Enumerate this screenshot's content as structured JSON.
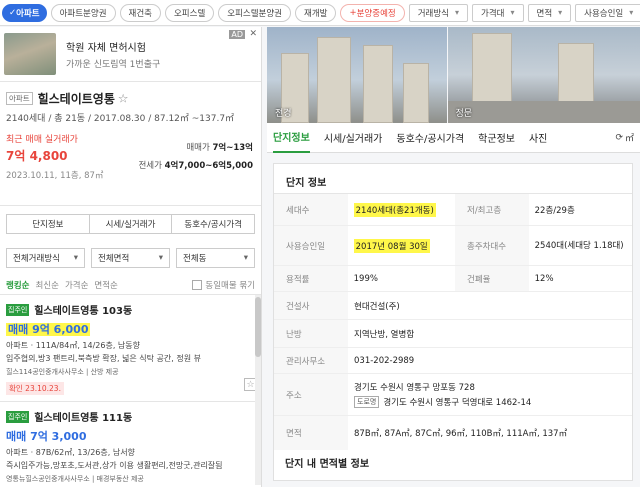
{
  "filters": {
    "active": "아파트",
    "chips": [
      "아파트분양권",
      "재건축",
      "오피스텔",
      "오피스텔분양권",
      "재개발"
    ],
    "highlight_chip": "분양중예정",
    "dropdowns": [
      "거래방식",
      "가격대",
      "면적",
      "사용승인일"
    ]
  },
  "ad": {
    "title": "학원 자체 면허시험",
    "subtitle": "가까운 신도림역 1번출구",
    "badge": "AD",
    "close": "✕"
  },
  "complex": {
    "tag": "아파트",
    "name": "힐스테이트영통",
    "star": "☆",
    "info": "2140세대 / 총 21동 / 2017.08.30 / 87.12㎡ ~137.7㎡",
    "recent_label": "최근 매매 실거래가",
    "recent_price": "7억 4,800",
    "recent_date": "2023.10.11, 11층, 87㎡",
    "sale_label": "매매가",
    "sale_value": "7억~13억",
    "lease_label": "전세가",
    "lease_value": "4억7,000~6억5,000"
  },
  "buttons": [
    "단지정보",
    "시세/실거래가",
    "동호수/공시가격"
  ],
  "selects": [
    "전체거래방식",
    "전체면적",
    "전체동"
  ],
  "sort": {
    "options": [
      "랭킹순",
      "최신순",
      "가격순",
      "면적순"
    ],
    "checkbox_label": "동일매물 묶기"
  },
  "listings": [
    {
      "badge": "집주인",
      "name": "힐스테이트영통 103동",
      "price": "매매 9억 6,000",
      "info": "아파트 · 111A/84㎡, 14/26층, 남동향",
      "desc": "입주협의,방3 팬트리,북측방 확장, 넓은 식탁 공간, 정원 뷰",
      "agency": "힐스114공인중개사사무소 | 산방 제공",
      "confirm": "확인 23.10.23."
    },
    {
      "badge": "집주인",
      "name": "힐스테이트영통 111동",
      "price": "매매 7억 3,000",
      "info": "아파트 · 87B/62㎡, 13/26층, 남서향",
      "desc": "즉시입주가능,망포초,도서관,상가 이용 생활편리,전망굿,관리잘됨",
      "agency": "영통뉴힐스공인중개사사무소 | 매경부동산 제공"
    }
  ],
  "photos": [
    {
      "label": "전경"
    },
    {
      "label": "정문"
    }
  ],
  "tabs": [
    "단지정보",
    "시세/실거래가",
    "동호수/공시가격",
    "학군정보",
    "사진"
  ],
  "tab_area_unit": "㎡",
  "info_card": {
    "title": "단지 정보",
    "rows": [
      {
        "l1": "세대수",
        "v1": "2140세대(총21개동)",
        "l2": "저/최고층",
        "v2": "22층/29층"
      },
      {
        "l1": "사용승인일",
        "v1": "2017년 08월 30일",
        "l2": "총주차대수",
        "v2": "2540대(세대당 1.18대)"
      },
      {
        "l1": "용적률",
        "v1": "199%",
        "l2": "건폐율",
        "v2": "12%"
      }
    ],
    "builder_label": "건설사",
    "builder": "현대건설(주)",
    "heating_label": "난방",
    "heating": "지역난방, 열병합",
    "office_label": "관리사무소",
    "office": "031-202-2989",
    "address_label": "주소",
    "address_lot": "경기도 수원시 영통구 망포동 728",
    "road_tag": "도로명",
    "address_road": "경기도 수원시 영통구 덕영대로 1462-14",
    "area_label": "면적",
    "area": "87B㎡, 87A㎡, 87C㎡, 96㎡, 110B㎡, 111A㎡, 137㎡"
  },
  "bottom_title": "단지 내 면적별 정보",
  "colors": {
    "primary_blue": "#2f6de0",
    "green": "#2a9d3f",
    "red": "#e8453c",
    "highlight": "#fff74a"
  }
}
